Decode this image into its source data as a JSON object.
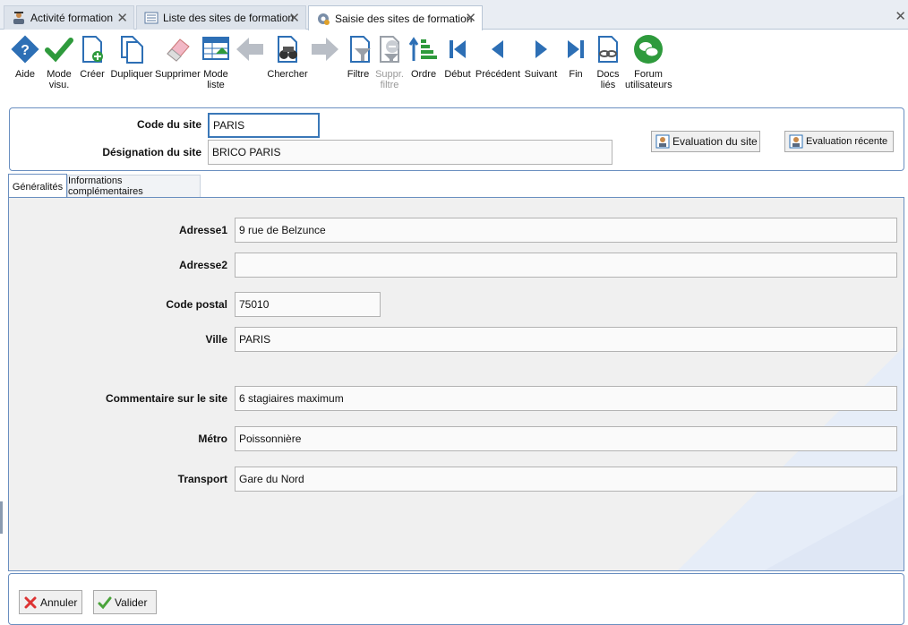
{
  "tabs": [
    {
      "label": "Activité formation",
      "icon": "graduation-icon",
      "active": false
    },
    {
      "label": "Liste des sites de formation",
      "icon": "list-icon",
      "active": false
    },
    {
      "label": "Saisie des sites de formation",
      "icon": "gear-icon",
      "active": true
    }
  ],
  "tab_close_glyph": "✕",
  "toolbar": {
    "aide": {
      "label": "Aide",
      "icon": "help-icon"
    },
    "mode_visu": {
      "label1": "Mode",
      "label2": "visu.",
      "icon": "checkmark-icon"
    },
    "creer": {
      "label": "Créer",
      "icon": "new-document-icon"
    },
    "dupliquer": {
      "label": "Dupliquer",
      "icon": "duplicate-icon"
    },
    "supprimer": {
      "label": "Supprimer",
      "icon": "eraser-icon"
    },
    "mode_liste": {
      "label1": "Mode",
      "label2": "liste",
      "icon": "table-icon"
    },
    "back_arrow": {
      "icon": "arrow-left-icon"
    },
    "chercher": {
      "label": "Chercher",
      "icon": "binoculars-icon"
    },
    "forward_arrow": {
      "icon": "arrow-right-icon"
    },
    "filtre": {
      "label": "Filtre",
      "icon": "filter-icon"
    },
    "suppr_filtre": {
      "label1": "Suppr.",
      "label2": "filtre",
      "icon": "remove-filter-icon"
    },
    "ordre": {
      "label": "Ordre",
      "icon": "sort-icon"
    },
    "debut": {
      "label": "Début",
      "icon": "first-icon"
    },
    "precedent": {
      "label": "Précédent",
      "icon": "previous-icon"
    },
    "suivant": {
      "label": "Suivant",
      "icon": "next-icon"
    },
    "fin": {
      "label": "Fin",
      "icon": "last-icon"
    },
    "docs_lies": {
      "label1": "Docs",
      "label2": "liés",
      "icon": "linked-docs-icon"
    },
    "forum": {
      "label1": "Forum",
      "label2": "utilisateurs",
      "icon": "forum-icon"
    }
  },
  "header": {
    "code_label": "Code du site",
    "code_value": "PARIS",
    "designation_label": "Désignation du site",
    "designation_value": "BRICO PARIS",
    "eval_site_button": "Evaluation du site",
    "eval_recente_button": "Evaluation récente"
  },
  "subtabs": {
    "generalites": "Généralités",
    "infos": "Informations complémentaires"
  },
  "form": {
    "adresse1_label": "Adresse1",
    "adresse1_value": "9 rue de Belzunce",
    "adresse2_label": "Adresse2",
    "adresse2_value": "",
    "code_postal_label": "Code postal",
    "code_postal_value": "75010",
    "ville_label": "Ville",
    "ville_value": "PARIS",
    "commentaire_label": "Commentaire sur le site",
    "commentaire_value": "6 stagiaires maximum",
    "metro_label": "Métro",
    "metro_value": "Poissonnière",
    "transport_label": "Transport",
    "transport_value": "Gare du Nord"
  },
  "footer": {
    "annuler": "Annuler",
    "valider": "Valider"
  },
  "colors": {
    "accent_border": "#6a8fc0",
    "focus_border": "#3b78b8",
    "deco_blue": "#dde6f5",
    "icon_blue": "#2d6fb5",
    "icon_green": "#2e9a3c",
    "icon_gray": "#9aa0a8"
  }
}
